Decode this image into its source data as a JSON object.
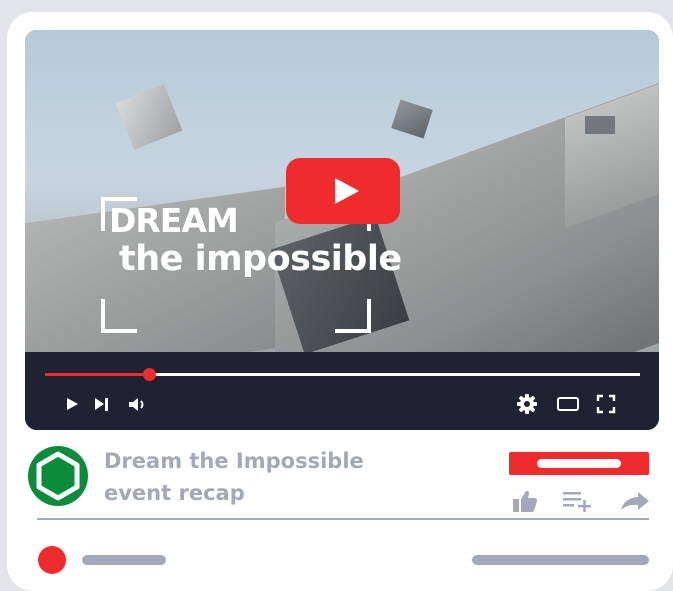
{
  "video": {
    "overlay_line1": "DREAM",
    "overlay_line2": "the impossible",
    "play_icon": "play-icon",
    "progress": 0.175
  },
  "controls": {
    "icons": [
      "play-icon",
      "skip-next-icon",
      "volume-icon",
      "settings-gear-icon",
      "theater-mode-icon",
      "fullscreen-icon"
    ]
  },
  "info": {
    "title_line1": "Dream the Impossible",
    "title_line2": "event recap",
    "channel_icon": "channel-hexagon-logo"
  },
  "actions": {
    "icons": [
      "like-thumbs-up-icon",
      "add-to-playlist-icon",
      "share-arrow-icon"
    ]
  },
  "colors": {
    "accent": "#ef2b2b",
    "player_bg": "#1f2230",
    "channel": "#0a8c3b",
    "muted_text": "#a3a8ba"
  }
}
